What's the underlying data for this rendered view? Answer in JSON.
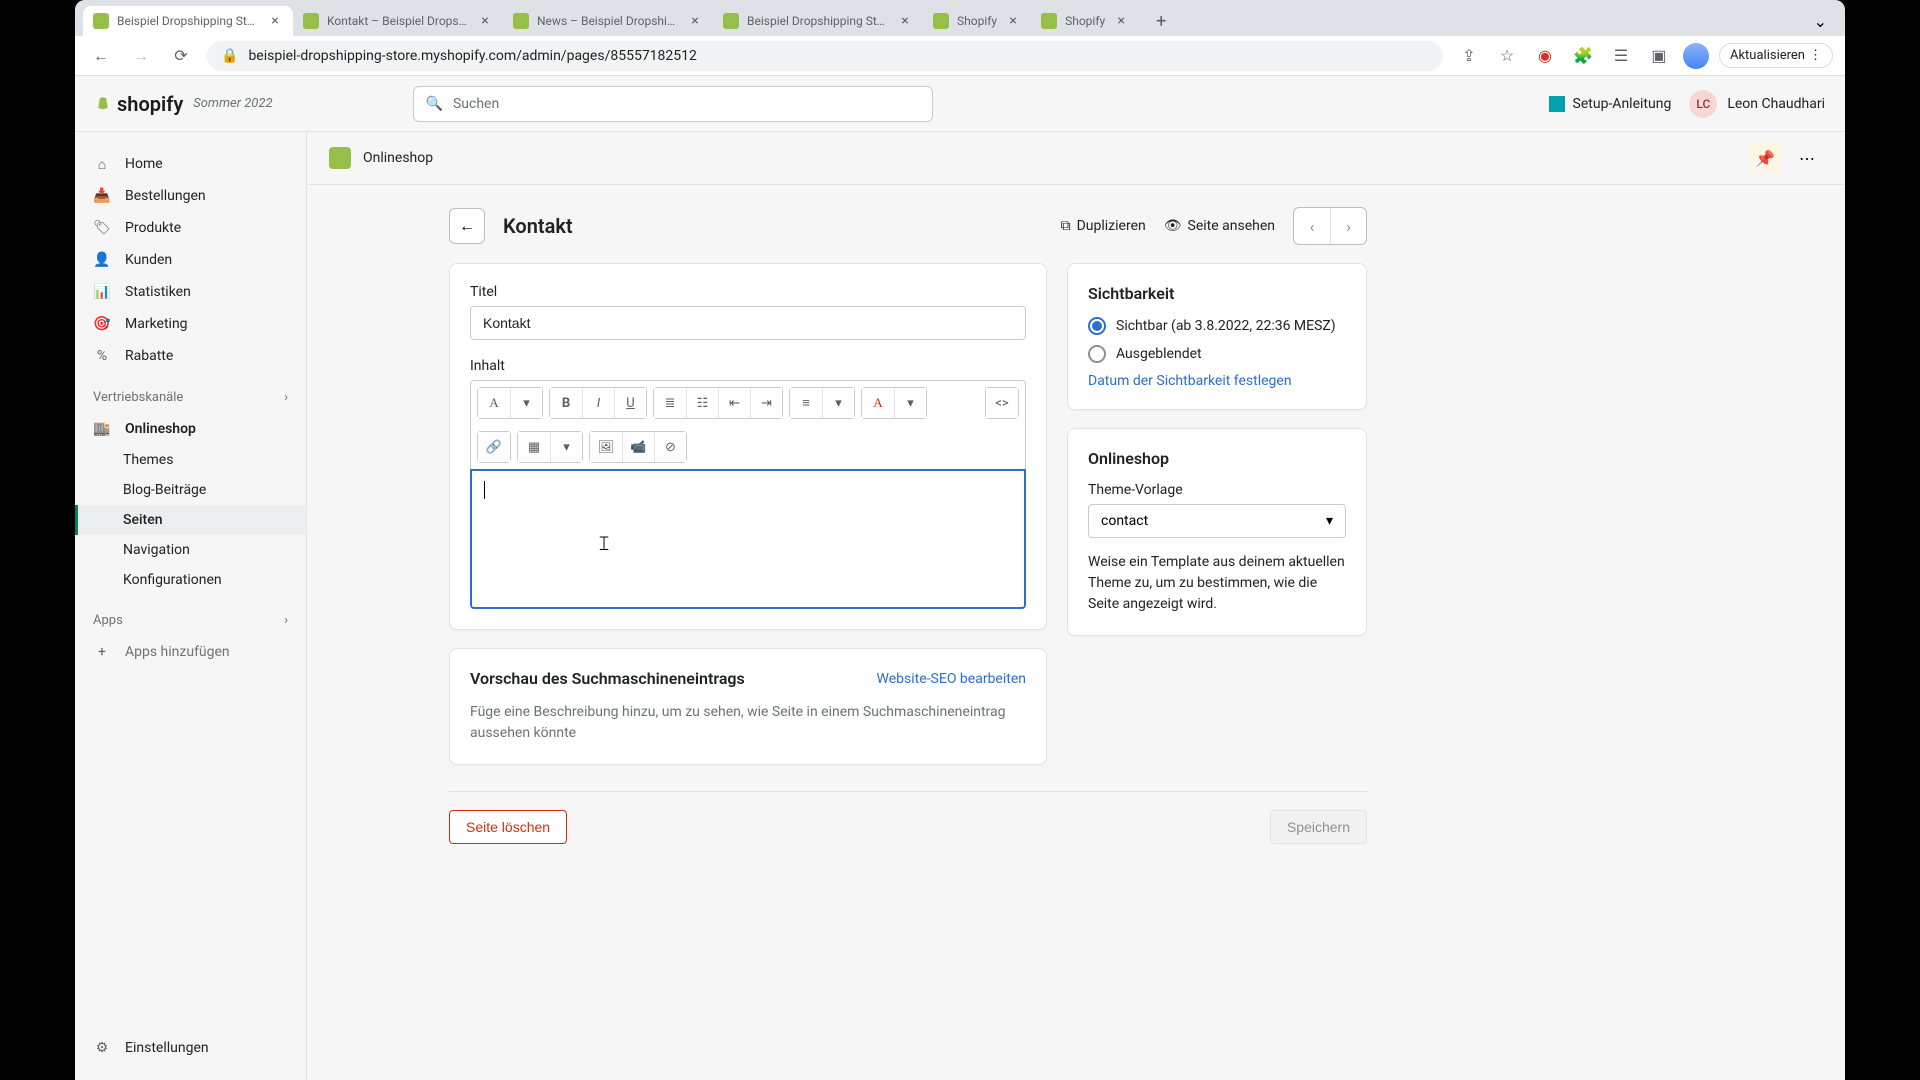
{
  "browser": {
    "tabs": [
      {
        "title": "Beispiel Dropshipping Store"
      },
      {
        "title": "Kontakt – Beispiel Dropshipp"
      },
      {
        "title": "News – Beispiel Dropshipp"
      },
      {
        "title": "Beispiel Dropshipping Store"
      },
      {
        "title": "Shopify"
      },
      {
        "title": "Shopify"
      }
    ],
    "url": "beispiel-dropshipping-store.myshopify.com/admin/pages/85557182512",
    "refresh_label": "Aktualisieren"
  },
  "header": {
    "logo": "shopify",
    "season": "Sommer 2022",
    "search_placeholder": "Suchen",
    "setup_guide": "Setup-Anleitung",
    "user_initials": "LC",
    "user_name": "Leon Chaudhari"
  },
  "sidebar": {
    "home": "Home",
    "orders": "Bestellungen",
    "products": "Produkte",
    "customers": "Kunden",
    "analytics": "Statistiken",
    "marketing": "Marketing",
    "discounts": "Rabatte",
    "channels_label": "Vertriebskanäle",
    "online_store": "Onlineshop",
    "themes": "Themes",
    "blog": "Blog-Beiträge",
    "pages": "Seiten",
    "navigation": "Navigation",
    "preferences": "Konfigurationen",
    "apps_label": "Apps",
    "add_apps": "Apps hinzufügen",
    "settings": "Einstellungen"
  },
  "context": {
    "title": "Onlineshop"
  },
  "page": {
    "back_aria": "Zurück",
    "title": "Kontakt",
    "duplicate": "Duplizieren",
    "view_page": "Seite ansehen",
    "title_label": "Titel",
    "title_value": "Kontakt",
    "content_label": "Inhalt"
  },
  "seo": {
    "title": "Vorschau des Suchmaschineneintrags",
    "edit_link": "Website-SEO bearbeiten",
    "description": "Füge eine Beschreibung hinzu, um zu sehen, wie Seite in einem Suchmaschineneintrag aussehen könnte"
  },
  "visibility": {
    "title": "Sichtbarkeit",
    "visible_label": "Sichtbar (ab 3.8.2022, 22:36 MESZ)",
    "hidden_label": "Ausgeblendet",
    "schedule_link": "Datum der Sichtbarkeit festlegen"
  },
  "template": {
    "title": "Onlineshop",
    "label": "Theme-Vorlage",
    "value": "contact",
    "help": "Weise ein Template aus deinem aktuellen Theme zu, um zu bestimmen, wie die Seite angezeigt wird."
  },
  "footer": {
    "delete": "Seite löschen",
    "save": "Speichern"
  }
}
